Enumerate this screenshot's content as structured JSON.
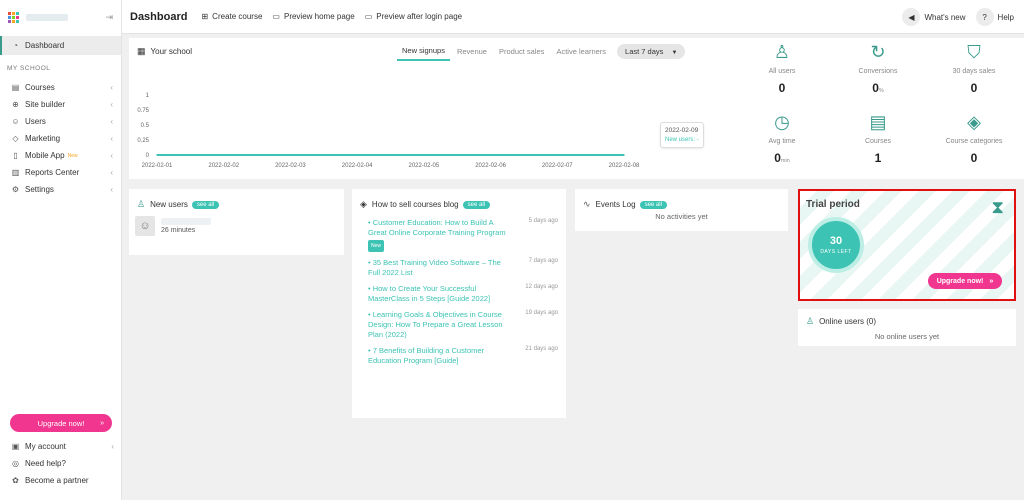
{
  "sidebar": {
    "dashboard": "Dashboard",
    "section_label": "MY SCHOOL",
    "items": [
      {
        "label": "Courses",
        "icon": "book-icon"
      },
      {
        "label": "Site builder",
        "icon": "globe-icon"
      },
      {
        "label": "Users",
        "icon": "user-icon"
      },
      {
        "label": "Marketing",
        "icon": "tag-icon"
      },
      {
        "label": "Mobile App",
        "icon": "phone-icon",
        "badge": "New"
      },
      {
        "label": "Reports Center",
        "icon": "chart-icon"
      },
      {
        "label": "Settings",
        "icon": "gear-icon"
      }
    ],
    "upgrade_label": "Upgrade now!",
    "upgrade_arrow": "»",
    "bottom_items": [
      {
        "label": "My account",
        "icon": "account-icon"
      },
      {
        "label": "Need help?",
        "icon": "help-icon"
      },
      {
        "label": "Become a partner",
        "icon": "partner-icon"
      }
    ]
  },
  "header": {
    "title": "Dashboard",
    "create_course": "Create course",
    "preview_home": "Preview home page",
    "preview_after_login": "Preview after login page",
    "whats_new": "What's new",
    "help": "Help"
  },
  "chart_panel": {
    "title": "Your school",
    "tabs": [
      "New signups",
      "Revenue",
      "Product sales",
      "Active learners"
    ],
    "active_tab": "New signups",
    "range": "Last 7 days",
    "tooltip_date": "2022-02-09",
    "tooltip_text": "New users: -"
  },
  "chart_data": {
    "type": "area",
    "title": "",
    "xlabel": "",
    "ylabel": "",
    "x": [
      "2022-02-01",
      "2022-02-02",
      "2022-02-03",
      "2022-02-04",
      "2022-02-05",
      "2022-02-06",
      "2022-02-07",
      "2022-02-08"
    ],
    "values": [
      0,
      0,
      0,
      0,
      0,
      0,
      0,
      0
    ],
    "y_ticks": [
      "1",
      "0.75",
      "0.5",
      "0.25",
      "0"
    ],
    "ylim": [
      0,
      1
    ],
    "color": "#3cc3b3"
  },
  "stats": [
    {
      "label": "All users",
      "value": "0",
      "unit": "",
      "icon": "user-icon"
    },
    {
      "label": "Conversions",
      "value": "0",
      "unit": "%",
      "icon": "refresh-icon"
    },
    {
      "label": "30 days sales",
      "value": "0",
      "unit": "",
      "icon": "bag-icon"
    },
    {
      "label": "Avg time",
      "value": "0",
      "unit": "min",
      "icon": "clock-icon"
    },
    {
      "label": "Courses",
      "value": "1",
      "unit": "",
      "icon": "document-icon"
    },
    {
      "label": "Course categories",
      "value": "0",
      "unit": "",
      "icon": "tag-icon"
    }
  ],
  "new_users": {
    "title": "New users",
    "see_all": "see all",
    "entries": [
      {
        "time": "26 minutes"
      }
    ]
  },
  "blog": {
    "title": "How to sell courses blog",
    "see_all": "see all",
    "new_badge": "New",
    "items": [
      {
        "title": "Customer Education: How to Build A Great Online Corporate Training Program",
        "date": "5 days ago",
        "is_new": true
      },
      {
        "title": "35 Best Training Video Software – The Full 2022 List",
        "date": "7 days ago",
        "is_new": false
      },
      {
        "title": "How to Create Your Successful MasterClass in 5 Steps [Guide 2022]",
        "date": "12 days ago",
        "is_new": false
      },
      {
        "title": "Learning Goals & Objectives in Course Design: How To Prepare a Great Lesson Plan (2022)",
        "date": "19 days ago",
        "is_new": false
      },
      {
        "title": "7 Benefits of Building a Customer Education Program [Guide]",
        "date": "21 days ago",
        "is_new": false
      }
    ]
  },
  "events": {
    "title": "Events Log",
    "see_all": "see all",
    "empty": "No activities yet"
  },
  "trial": {
    "title": "Trial period",
    "days": "30",
    "days_label": "DAYS LEFT",
    "upgrade": "Upgrade now!",
    "arrow": "»"
  },
  "online": {
    "title": "Online users (0)",
    "empty": "No online users yet"
  },
  "colors": {
    "accent": "#3cc3b3",
    "pink": "#f0368f",
    "highlight_border": "#e01010"
  }
}
